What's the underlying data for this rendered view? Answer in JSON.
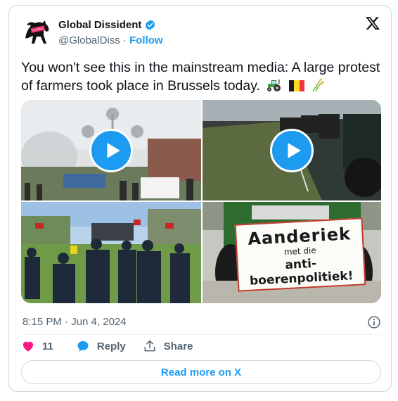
{
  "author": {
    "display_name": "Global Dissident",
    "handle": "@GlobalDiss",
    "separator": " · ",
    "follow_label": "Follow",
    "verified": true
  },
  "tweet": {
    "text": "You won't see this in the mainstream media: A large protest of farmers took place in Brussels today.",
    "emojis": [
      "tractor",
      "belgium-flag",
      "sheaf-of-rice"
    ]
  },
  "media": {
    "tiles": [
      {
        "type": "video",
        "subject": "Atomium with crowd"
      },
      {
        "type": "video",
        "subject": "tractors on road at dusk"
      },
      {
        "type": "photo",
        "subject": "protesters with flags"
      },
      {
        "type": "photo",
        "subject": "tractor with sign"
      }
    ],
    "sign_text": {
      "line1": "Aanderiek",
      "line2": "met die",
      "line3": "anti-boerenpolitiek!"
    }
  },
  "timestamp": "8:15 PM · Jun 4, 2024",
  "actions": {
    "like_count": "11",
    "reply_label": "Reply",
    "share_label": "Share"
  },
  "read_more_label": "Read more on X",
  "colors": {
    "accent": "#1d9bf0",
    "like": "#f91880",
    "text": "#0f1419",
    "muted": "#536471"
  }
}
